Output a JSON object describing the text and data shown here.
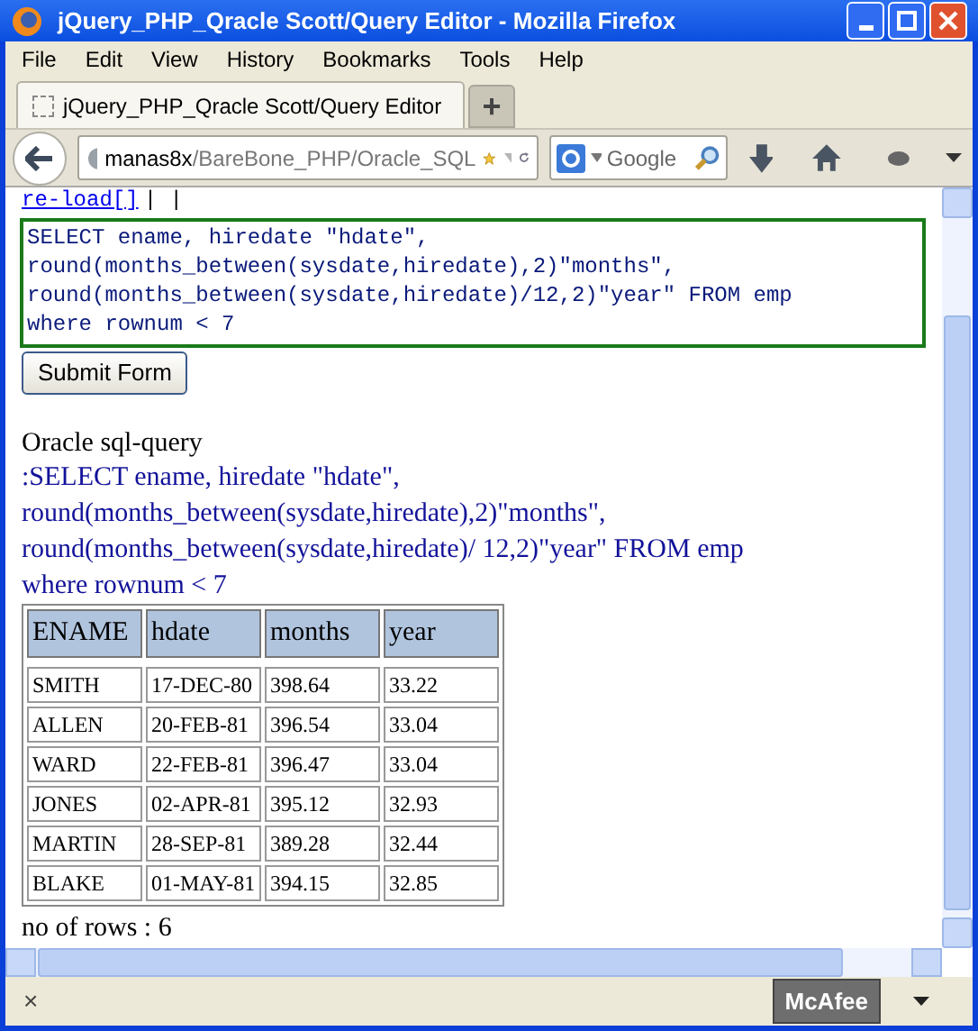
{
  "window": {
    "title": "jQuery_PHP_Qracle Scott/Query Editor - Mozilla Firefox"
  },
  "menu": [
    "File",
    "Edit",
    "View",
    "History",
    "Bookmarks",
    "Tools",
    "Help"
  ],
  "tabs": [
    {
      "label": "jQuery_PHP_Qracle Scott/Query Editor",
      "selected": true
    }
  ],
  "new_tab": "+",
  "address": {
    "host": "manas8x",
    "path": "/BareBone_PHP/Oracle_SQL"
  },
  "search": {
    "placeholder": "Google"
  },
  "page": {
    "reload_link": "re-load[]",
    "reload_suffix": "| |",
    "query_lines": [
      "SELECT ename, hiredate \"hdate\",",
      "round(months_between(sysdate,hiredate),2)\"months\",",
      "round(months_between(sysdate,hiredate)/12,2)\"year\" FROM emp",
      "where rownum < 7"
    ],
    "submit": "Submit Form",
    "result_heading": "Oracle sql-query",
    "result_query_lines": [
      ":SELECT ename, hiredate \"hdate\",",
      "round(months_between(sysdate,hiredate),2)\"months\",",
      "round(months_between(sysdate,hiredate)/ 12,2)\"year\" FROM emp",
      "where rownum < 7"
    ],
    "table": {
      "columns": [
        "ENAME",
        "hdate",
        "months",
        "year"
      ],
      "rows": [
        [
          "SMITH",
          "17-DEC-80",
          "398.64",
          "33.22"
        ],
        [
          "ALLEN",
          "20-FEB-81",
          "396.54",
          "33.04"
        ],
        [
          "WARD",
          "22-FEB-81",
          "396.47",
          "33.04"
        ],
        [
          "JONES",
          "02-APR-81",
          "395.12",
          "32.93"
        ],
        [
          "MARTIN",
          "28-SEP-81",
          "389.28",
          "32.44"
        ],
        [
          "BLAKE",
          "01-MAY-81",
          "394.15",
          "32.85"
        ]
      ]
    },
    "row_count": "no of rows : 6"
  },
  "status_bar": {
    "close": "×",
    "badge": "McAfee"
  }
}
